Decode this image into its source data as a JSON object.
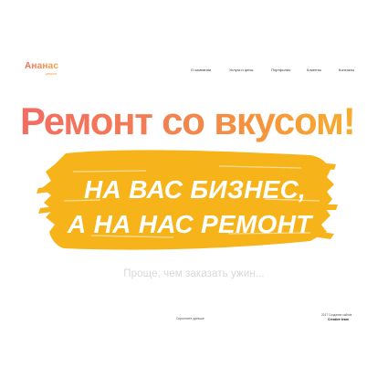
{
  "logo": {
    "name": "Ананас",
    "tagline": "ремонт"
  },
  "nav": {
    "items": [
      "О компании",
      "Услуги и цены",
      "Портфолио",
      "Клиенты",
      "Контакты"
    ]
  },
  "hero": {
    "headline": "Ремонт со вкусом!",
    "slogan_line_1": "НА ВАС БИЗНЕС,",
    "slogan_line_2": "А НА НАС РЕМОНТ",
    "subtitle": "Проще, чем заказать ужин...",
    "brush_color": "#f6b41a",
    "accent_gradient": [
      "#f36b62",
      "#f9b02a"
    ]
  },
  "footer": {
    "scroll_link": "Скроллите дальше",
    "credits_line_1": "2017 Создание сайтов",
    "credits_line_2": "Creative team"
  }
}
